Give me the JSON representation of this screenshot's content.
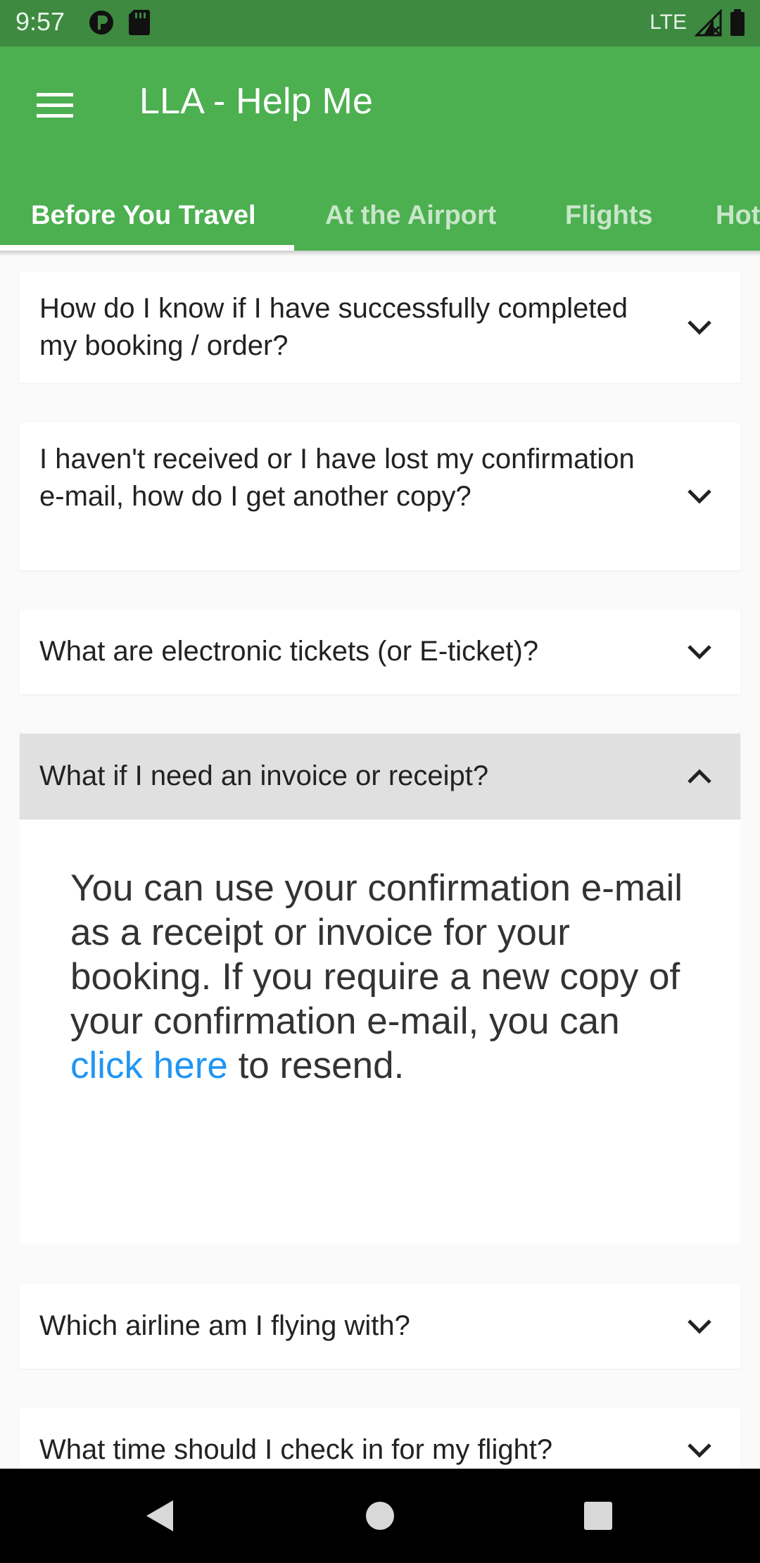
{
  "status_bar": {
    "time": "9:57",
    "network": "LTE"
  },
  "app_bar": {
    "title": "LLA - Help Me",
    "color": "#4caf50"
  },
  "tabs": [
    {
      "label": "Before You Travel",
      "active": true
    },
    {
      "label": "At the Airport",
      "active": false
    },
    {
      "label": "Flights",
      "active": false
    },
    {
      "label": "Hot",
      "active": false
    }
  ],
  "faq": [
    {
      "question": "How do I know if I have successfully completed my booking / order?",
      "expanded": false
    },
    {
      "question": "I haven't received or I have lost my confirmation e-mail, how do I get another copy?",
      "expanded": false
    },
    {
      "question": "What are electronic tickets (or E-ticket)?",
      "expanded": false
    },
    {
      "question": "What if I need an invoice or receipt?",
      "expanded": true
    },
    {
      "question": "Which airline am I flying with?",
      "expanded": false
    },
    {
      "question": "What time should I check in for my flight?",
      "expanded": false
    }
  ],
  "answer": {
    "text_before": "You can use your confirmation e-mail as a receipt or invoice for your booking. If you require a new copy of your confirmation e-mail, you can ",
    "link_text": "click here",
    "text_after": " to resend.",
    "link_color": "#2196f3"
  },
  "icons": {
    "menu": "menu-icon",
    "expand": "chevron-down-icon",
    "collapse": "chevron-up-icon",
    "back": "nav-back-icon",
    "home": "nav-home-icon",
    "recents": "nav-recents-icon"
  }
}
